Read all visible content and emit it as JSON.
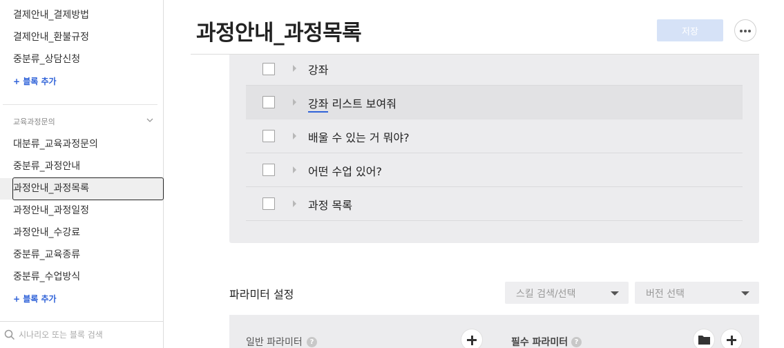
{
  "sidebar": {
    "items_top": [
      "결제안내_결제방법",
      "결제안내_환불규정",
      "중분류_상담신청"
    ],
    "add_block_label": "+ 블록 추가",
    "group_title": "교육과정문의",
    "items_group": [
      "대분류_교육과정문의",
      "중분류_과정안내",
      "과정안내_과정목록",
      "과정안내_과정일정",
      "과정안내_수강료",
      "중분류_교육종류",
      "중분류_수업방식"
    ],
    "active_item": "과정안내_과정목록",
    "search_placeholder": "시나리오 또는 블록 검색"
  },
  "header": {
    "title": "과정안내_과정목록",
    "save_label": "저장"
  },
  "utterances": [
    {
      "text": "강좌"
    },
    {
      "text_underlined": "강좌",
      "text_rest": " 리스트 보여줘"
    },
    {
      "text": "배울 수 있는 거 뭐야?"
    },
    {
      "text": "어떤 수업 있어?"
    },
    {
      "text": "과정 목록"
    }
  ],
  "params": {
    "title": "파라미터 설정",
    "skill_dropdown": "스킬 검색/선택",
    "version_dropdown": "버전 선택",
    "general_label": "일반 파라미터",
    "required_label": "필수 파라미터",
    "help_glyph": "?"
  },
  "colors": {
    "accent": "#2f62d8",
    "save_disabled": "#d6e2f7",
    "panel_bg": "#ececee"
  }
}
